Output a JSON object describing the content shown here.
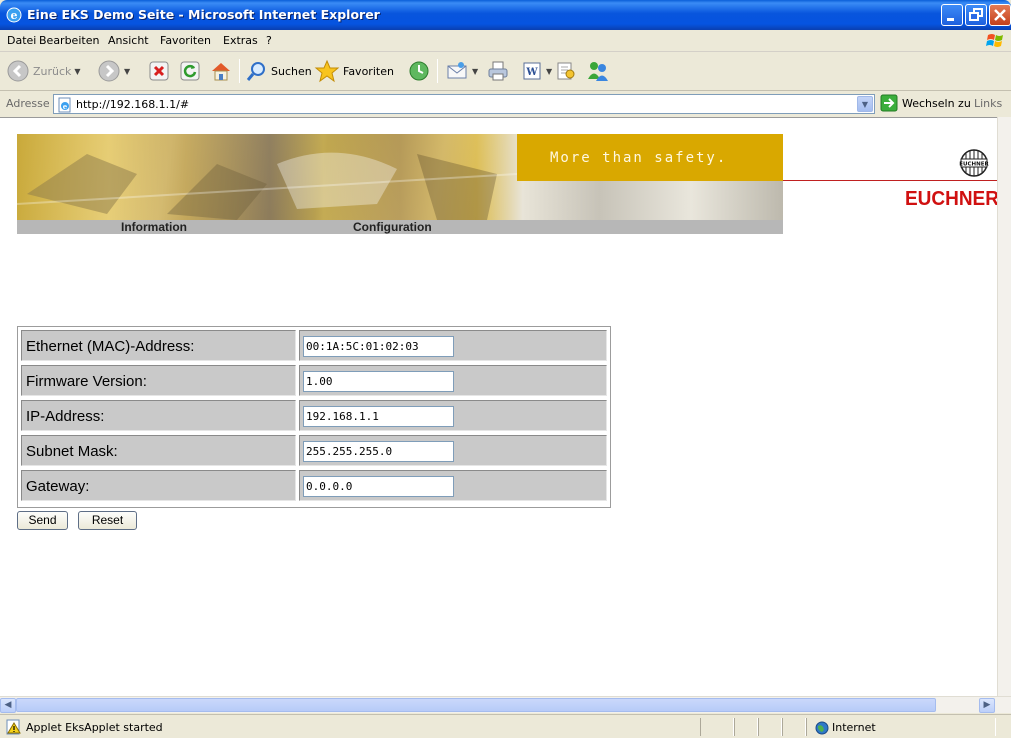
{
  "window": {
    "title": "Eine EKS Demo Seite - Microsoft Internet Explorer"
  },
  "menu": {
    "items": [
      "Datei",
      "Bearbeiten",
      "Ansicht",
      "Favoriten",
      "Extras",
      "?"
    ]
  },
  "toolbar": {
    "back_label": "Zurück",
    "search_label": "Suchen",
    "favorites_label": "Favoriten"
  },
  "address": {
    "label": "Adresse",
    "url": "http://192.168.1.1/#",
    "go_label": "Wechseln zu",
    "links_label": "Links"
  },
  "banner": {
    "slogan": "More than safety.",
    "nav": [
      "Information",
      "Configuration"
    ],
    "brand_name": "EUCHNER",
    "logo_text": "EUCHNER",
    "slogan_color": "#d9a800",
    "brand_color": "#d01010"
  },
  "form": {
    "rows": [
      {
        "label": "Ethernet (MAC)-Address:",
        "value": "00:1A:5C:01:02:03"
      },
      {
        "label": "Firmware Version:",
        "value": "1.00"
      },
      {
        "label": "IP-Address:",
        "value": "192.168.1.1"
      },
      {
        "label": "Subnet Mask:",
        "value": "255.255.255.0"
      },
      {
        "label": "Gateway:",
        "value": "0.0.0.0"
      }
    ],
    "send_label": "Send",
    "reset_label": "Reset"
  },
  "status": {
    "text": "Applet EksApplet started",
    "zone": "Internet"
  }
}
